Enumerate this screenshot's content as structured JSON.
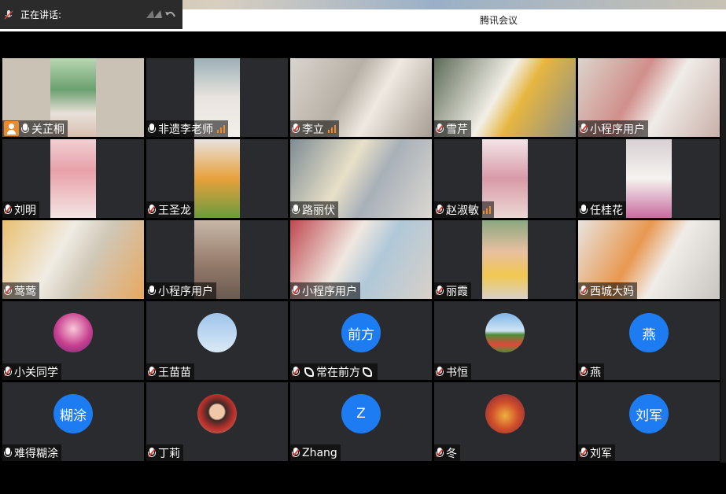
{
  "window": {
    "title": "腾讯会议"
  },
  "speaking_bar": {
    "label": "正在讲话:"
  },
  "colors": {
    "avatar_blue": "#1e7cf2",
    "tile_bg": "#2a2b2e",
    "host_orange": "#e88a2e",
    "signal_orange": "#ef8a2a"
  },
  "participants": [
    {
      "name": "关芷桐",
      "mic": "on",
      "host": true,
      "signal": false
    },
    {
      "name": "非遗李老师",
      "mic": "on",
      "signal": true
    },
    {
      "name": "李立",
      "mic": "muted",
      "signal": true
    },
    {
      "name": "雪芹",
      "mic": "muted",
      "signal": false
    },
    {
      "name": "小程序用户",
      "mic": "muted",
      "signal": false
    },
    {
      "name": "刘明",
      "mic": "muted",
      "signal": false
    },
    {
      "name": "王圣龙",
      "mic": "muted",
      "signal": false
    },
    {
      "name": "路丽伏",
      "mic": "on",
      "signal": false
    },
    {
      "name": "赵淑敏",
      "mic": "muted",
      "signal": true
    },
    {
      "name": "任桂花",
      "mic": "on",
      "signal": false
    },
    {
      "name": "莺莺",
      "mic": "muted",
      "signal": false
    },
    {
      "name": "小程序用户",
      "mic": "on",
      "signal": false
    },
    {
      "name": "小程序用户",
      "mic": "muted",
      "signal": false
    },
    {
      "name": "丽霞",
      "mic": "muted",
      "signal": false
    },
    {
      "name": "西城大妈",
      "mic": "muted",
      "signal": false
    },
    {
      "name": "小关同学",
      "mic": "muted",
      "signal": false,
      "avatar_icon": "cartoon-avatar-icon"
    },
    {
      "name": "王苗苗",
      "mic": "muted",
      "signal": false,
      "avatar_icon": "sky-photo-avatar-icon"
    },
    {
      "name": "常在前方",
      "mic": "muted",
      "signal": false,
      "phone": true,
      "avatar_text": "前方"
    },
    {
      "name": "书恒",
      "mic": "muted",
      "signal": false,
      "avatar_icon": "field-photo-avatar-icon"
    },
    {
      "name": "燕",
      "mic": "muted",
      "signal": false,
      "avatar_text": "燕"
    },
    {
      "name": "难得糊涂",
      "mic": "on",
      "signal": false,
      "avatar_text": "糊涂"
    },
    {
      "name": "丁莉",
      "mic": "muted",
      "signal": false,
      "avatar_icon": "person-photo-avatar-icon"
    },
    {
      "name": "Zhang",
      "mic": "muted",
      "signal": false,
      "avatar_text": "Z"
    },
    {
      "name": "冬",
      "mic": "muted",
      "signal": false,
      "avatar_icon": "dragon-avatar-icon"
    },
    {
      "name": "刘军",
      "mic": "muted",
      "signal": false,
      "avatar_text": "刘军"
    }
  ]
}
